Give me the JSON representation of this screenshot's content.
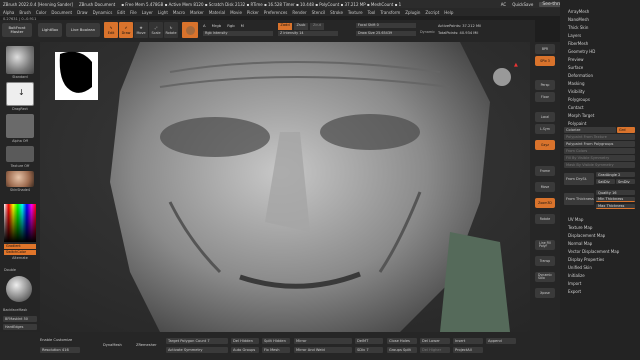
{
  "title_bar": {
    "app": "ZBrush 2022.0.4 [Henning Sander]",
    "document": "ZBrush Document",
    "free_mem": "▪ Free Mem 5.478GB ▪ Active Mem 8120 ▪ Scratch Disk 2132 ▪ RTime ▪ 16.528 Timer ▪ 10.448 ▪ PolyCount ▪ 37.212 MP ▪ MeshCount ▪ 1",
    "ac": "AC",
    "quicksave": "QuickSave",
    "see_through": "See-through  0",
    "menus_btn": "Menus",
    "script": "DefaultZScript"
  },
  "menu": [
    "Alpha",
    "Brush",
    "Color",
    "Document",
    "Draw",
    "Dynamics",
    "Edit",
    "File",
    "Layer",
    "Light",
    "Macro",
    "Marker",
    "Material",
    "Movie",
    "Picker",
    "Preferences",
    "Render",
    "Stencil",
    "Stroke",
    "Texture",
    "Tool",
    "Transform",
    "Zplugin",
    "Zscript",
    "Help"
  ],
  "status": "0.27631 | 0.-0.911",
  "shelf": {
    "bpr": "BPR",
    "spix": "SPix 3",
    "persp": "Persp",
    "floor": "Floor",
    "subtools_label": "SubTool",
    "frame": "Frame",
    "move": "Move",
    "scale": "Scale",
    "rotate": "Rotate",
    "polyf": "PolyF",
    "transp": "Transp",
    "ghost": "Ghost",
    "solo": "Solo",
    "xpose": "Xpose",
    "split": "Split"
  },
  "toolbar": {
    "bolt_front": "BoltFront\nMaster",
    "lightbox": "LightBox",
    "live_boolean": "Live Boolean",
    "edit": "Edit",
    "draw": "Draw",
    "move": "Move",
    "scale": "Scale",
    "rotate": "Rotate",
    "a_label": "A",
    "mrgb": "Mrgb",
    "rgb": "Rgb",
    "m": "M",
    "zadd": "Zadd",
    "zsub": "Zsub",
    "zcut": "Zcut",
    "rgb_intensity": "Rgb Intensity",
    "z_intensity": "Z Intensity 14",
    "focal_shift": "Focal Shift 0",
    "draw_size": "Draw Size 25.65439",
    "dynamic": "Dynamic",
    "active_points": "ActivePoints: 37.212 Mil",
    "total_points": "TotalPoints: 40.934 Mil"
  },
  "left_panel": {
    "brush_name": "Standard",
    "stroke_name": "DragRect",
    "alpha_name": "Alpha Off",
    "texture_name": "Texture Off",
    "material_name": "SkinShade4",
    "gradient": "Gradient",
    "switch_color": "SwitchColor",
    "alternate": "Alternate",
    "double": "Double",
    "backface_mask": "BackfaceMask",
    "bf_mask_int": "BFMaskInt 50",
    "hard_edges": "HardEdges",
    "soft_edges": "SoftEdges"
  },
  "right_strip": [
    "BPR",
    "SPix 3",
    "Persp",
    "Floor",
    "Local",
    "L.Sym",
    "Gxyz",
    "Frame",
    "Move",
    "Zoom3D",
    "Rotate",
    "Line Fill\nPolyF",
    "Transp",
    "Dynamic\nSolo",
    "Xpose"
  ],
  "right_panel": {
    "items_top": [
      "ArrayMesh",
      "NanoMesh",
      "Thick Skin",
      "Layers",
      "FiberMesh",
      "Geometry HD",
      "Preview",
      "Surface",
      "Deformation",
      "Masking",
      "Visibility",
      "Polygroups",
      "Contact",
      "Morph Target",
      "Polypaint"
    ],
    "colorize": "Colorize",
    "grd": "Grd",
    "polypaint_from_texture": "Polypaint From Texture",
    "polypaint_from_polygroups": "Polypaint From Polygroups",
    "from_colors": "From Colors",
    "fill_by_visible": "Fill By Visible Symmetry",
    "mask_by_visible": "Mask By Visible Symmetry",
    "from_dryb": "From DrySt.",
    "grad_angle": "GradAngle 2",
    "satdiv": "SatDiv",
    "smdiv": "SmDiv",
    "from_thickness": "From Thickness",
    "quality": "Quality 16",
    "min_thickness": "Min Thickness",
    "max_thickness": "Max Thickness",
    "items_bottom": [
      "UV Map",
      "Texture Map",
      "Displacement Map",
      "Normal Map",
      "Vector Displacement Map",
      "Display Properties",
      "Unified Skin",
      "Initialize",
      "Import",
      "Export"
    ]
  },
  "bottom_bar": {
    "enable_customize": "Enable Customize",
    "resolution": "Resolution 416",
    "dynamesh": "DynaMesh",
    "zremesher": "ZRemesher",
    "target_polygon_count": "Target Polygon Count 7",
    "activate_symmetry": "Activate Symmetry",
    "del_hidden": "Del Hidden",
    "auto_groups": "Auto Groups",
    "split_hidden": "Split Hidden",
    "fix_mesh": "Fix Mesh",
    "mirror": "Mirror",
    "mirror_and_weld": "Mirror And Weld",
    "mirror_short": "Mirror",
    "del_mt": "DelMT",
    "sdiv": "SDiv 7",
    "close_holes": "Close Holes",
    "groups_split": "Groups Split",
    "del_lower": "Del Lower",
    "del_higher": "Del Higher",
    "insert": "Insert",
    "project_all": "ProjectAll",
    "append": "Append"
  },
  "colors": {
    "accent": "#d9732c",
    "panel": "#262626",
    "viewport_bg": "#333333"
  }
}
